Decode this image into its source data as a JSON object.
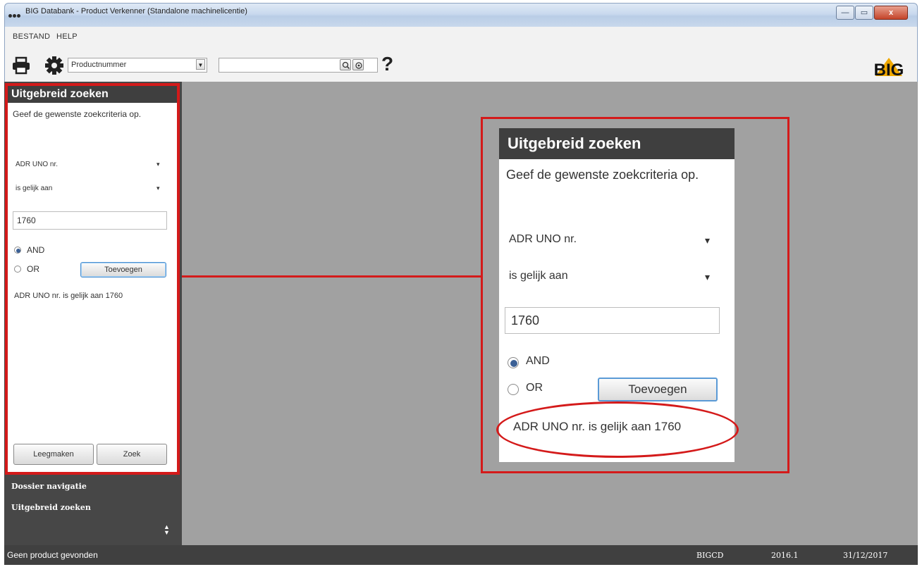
{
  "window": {
    "title": "BIG Databank - Product Verkenner (Standalone machinelicentie)",
    "minimize": "—",
    "maximize": "▭",
    "close": "x"
  },
  "menu": {
    "bestand": "BESTAND",
    "help": "HELP"
  },
  "toolbar": {
    "search_field_select": "Productnummer",
    "search_value": "",
    "help_glyph": "?",
    "logo_text": "BIG"
  },
  "advanced_search": {
    "title": "Uitgebreid zoeken",
    "instruction": "Geef de gewenste zoekcriteria op.",
    "field_select": "ADR UNO nr.",
    "operator_select": "is gelijk aan",
    "value": "1760",
    "logic_and": "AND",
    "logic_or": "OR",
    "selected_logic": "AND",
    "add_button": "Toevoegen",
    "criteria": [
      "ADR UNO nr. is gelijk aan 1760"
    ],
    "clear_button": "Leegmaken",
    "search_button": "Zoek"
  },
  "nav": {
    "items": [
      "Dossier navigatie",
      "Uitgebreid zoeken"
    ]
  },
  "status": {
    "message": "Geen product gevonden",
    "db": "BIGCD",
    "version": "2016.1",
    "date": "31/12/2017"
  },
  "colors": {
    "highlight_red": "#d41a1a",
    "panel_dark": "#3f3f3f",
    "workspace_gray": "#a1a1a1",
    "logo_yellow": "#f0a800"
  }
}
